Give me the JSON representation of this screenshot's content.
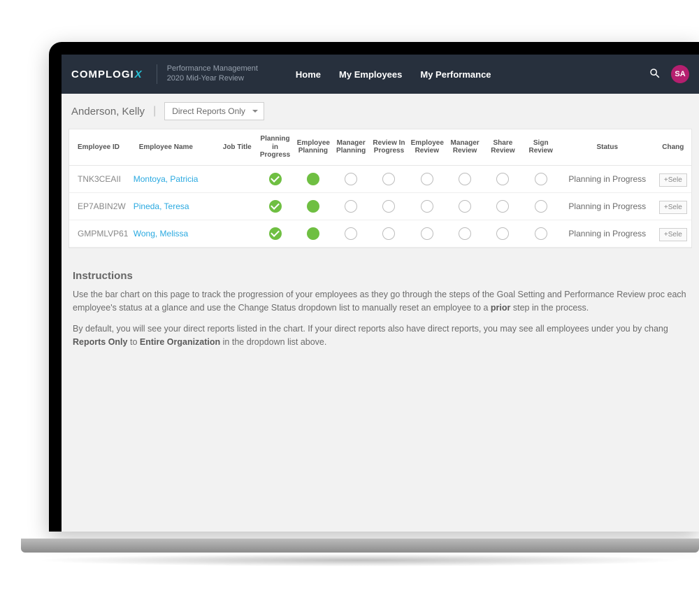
{
  "header": {
    "brand_comp": "COMP",
    "brand_logi": "LOGI",
    "brand_x": "X",
    "sub_line1": "Performance Management",
    "sub_line2": "2020 Mid-Year Review",
    "nav": {
      "home": "Home",
      "my_employees": "My Employees",
      "my_performance": "My Performance"
    },
    "avatar_initials": "SA"
  },
  "subbar": {
    "user_name": "Anderson, Kelly",
    "divider": "|",
    "scope_selected": "Direct Reports Only"
  },
  "table": {
    "headers": {
      "employee_id": "Employee ID",
      "employee_name": "Employee Name",
      "job_title": "Job Title",
      "planning_in_progress": "Planning in Progress",
      "employee_planning": "Employee Planning",
      "manager_planning": "Manager Planning",
      "review_in_progress": "Review In Progress",
      "employee_review": "Employee Review",
      "manager_review": "Manager Review",
      "share_review": "Share Review",
      "sign_review": "Sign Review",
      "status": "Status",
      "change": "Chang"
    },
    "select_label": "+Sele",
    "rows": [
      {
        "id": "TNK3CEAII",
        "name": "Montoya, Patricia",
        "steps": [
          "check",
          "solid",
          "empty",
          "empty",
          "empty",
          "empty",
          "empty",
          "empty"
        ],
        "status": "Planning in Progress"
      },
      {
        "id": "EP7ABIN2W",
        "name": "Pineda, Teresa",
        "steps": [
          "check",
          "solid",
          "empty",
          "empty",
          "empty",
          "empty",
          "empty",
          "empty"
        ],
        "status": "Planning in Progress"
      },
      {
        "id": "GMPMLVP61",
        "name": "Wong, Melissa",
        "steps": [
          "check",
          "solid",
          "empty",
          "empty",
          "empty",
          "empty",
          "empty",
          "empty"
        ],
        "status": "Planning in Progress"
      }
    ]
  },
  "instructions": {
    "title": "Instructions",
    "p1_a": "Use the bar chart on this page to track the progression of your employees as they go through the steps of the Goal Setting and Performance Review proc",
    "p1_b": "each employee's status at a glance and use the Change Status dropdown list to manually reset an employee to a ",
    "p1_bold": "prior",
    "p1_c": " step in the process.",
    "p2_a": "By default, you will see your direct reports listed in the chart. If your direct reports also have direct reports, you may see all employees under you by chang",
    "p2_bold1": "Reports Only",
    "p2_mid": " to ",
    "p2_bold2": "Entire Organization",
    "p2_c": " in the dropdown list above."
  }
}
